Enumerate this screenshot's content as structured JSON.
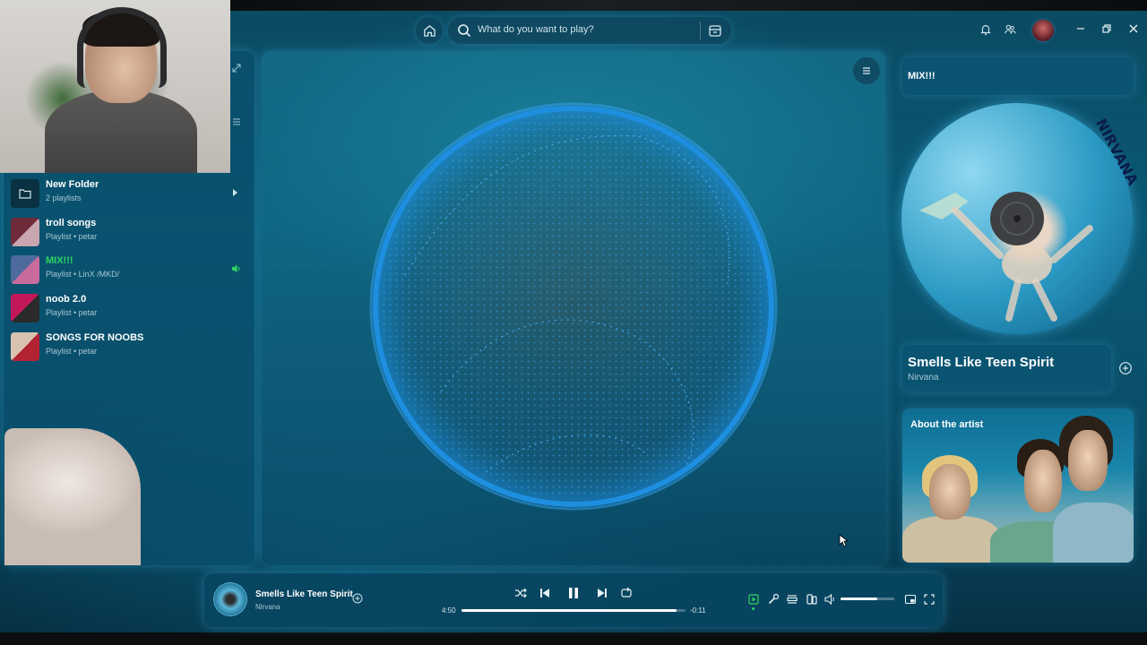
{
  "top": {
    "search_placeholder": "What do you want to play?"
  },
  "sidebar": {
    "items": [
      {
        "title": "New Folder",
        "subtitle": "2 playlists",
        "type": "folder"
      },
      {
        "title": "troll songs",
        "subtitle": "Playlist • petar",
        "type": "playlist"
      },
      {
        "title": "MIX!!!",
        "subtitle": "Playlist • LinX /MKD/",
        "type": "playlist",
        "active": true
      },
      {
        "title": "noob 2.0",
        "subtitle": "Playlist • petar",
        "type": "playlist"
      },
      {
        "title": "SONGS FOR NOOBS",
        "subtitle": "Playlist • petar",
        "type": "playlist"
      }
    ]
  },
  "right_panel": {
    "playlist_title": "MIX!!!",
    "album_lettering": "NIRVANA",
    "song_title": "Smells Like Teen Spirit",
    "artist": "Nirvana",
    "about_label": "About the artist"
  },
  "player": {
    "title": "Smells Like Teen Spirit",
    "artist": "Nirvana",
    "elapsed": "4:50",
    "remaining": "-0:11",
    "progress": 0.96,
    "volume": 0.68
  },
  "colors": {
    "accent_green": "#2fd462",
    "visualizer_blue": "#1e8fe0",
    "panel_bg": "#0a5573"
  }
}
